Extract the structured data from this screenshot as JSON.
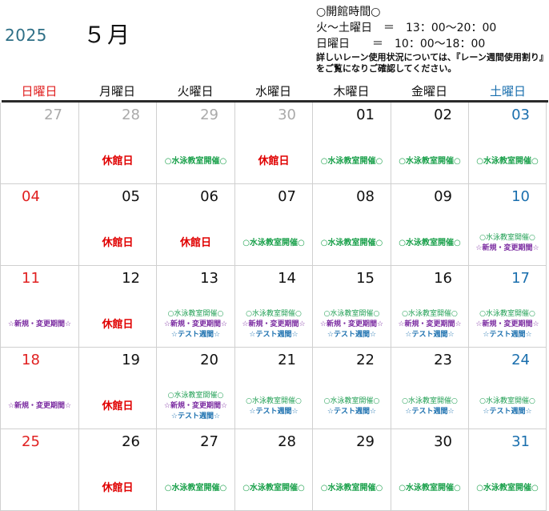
{
  "header": {
    "year": "2025",
    "month": "５月",
    "hours_title": "○開館時間○",
    "hours_weekday": "火～土曜日　＝　13：00～20：00",
    "hours_sunday": "日曜日　　＝　10：00～18：00",
    "note_line1": "詳しいレーン使用状況については、『レーン週間使用割り』",
    "note_line2": "をご覧になりご確認してください。"
  },
  "weekdays": [
    {
      "label": "日曜日",
      "kind": "sun"
    },
    {
      "label": "月曜日",
      "kind": "wd"
    },
    {
      "label": "火曜日",
      "kind": "wd"
    },
    {
      "label": "水曜日",
      "kind": "wd"
    },
    {
      "label": "木曜日",
      "kind": "wd"
    },
    {
      "label": "金曜日",
      "kind": "wd"
    },
    {
      "label": "土曜日",
      "kind": "sat"
    }
  ],
  "labels": {
    "closed": "休館日",
    "swim": "○水泳教室開催○",
    "newreg": "☆新規・変更期間☆",
    "test": "☆テスト週間☆"
  },
  "colors": {
    "sunday": "#e02020",
    "saturday": "#1a6fae",
    "closed": "#e00000",
    "swim": "#19a04a",
    "newreg": "#7a2aa0",
    "test": "#1a6fae"
  },
  "weeks": [
    [
      {
        "day": "27",
        "other": true,
        "events": []
      },
      {
        "day": "28",
        "other": true,
        "events": [
          "closed"
        ]
      },
      {
        "day": "29",
        "other": true,
        "events": [
          "swim"
        ]
      },
      {
        "day": "30",
        "other": true,
        "events": [
          "closed"
        ]
      },
      {
        "day": "01",
        "events": [
          "swim"
        ]
      },
      {
        "day": "02",
        "events": [
          "swim"
        ]
      },
      {
        "day": "03",
        "events": [
          "swim"
        ]
      }
    ],
    [
      {
        "day": "04",
        "events": []
      },
      {
        "day": "05",
        "events": [
          "closed"
        ]
      },
      {
        "day": "06",
        "events": [
          "closed"
        ]
      },
      {
        "day": "07",
        "events": [
          "swim"
        ]
      },
      {
        "day": "08",
        "events": [
          "swim"
        ]
      },
      {
        "day": "09",
        "events": [
          "swim"
        ]
      },
      {
        "day": "10",
        "events": [
          "swim_small",
          "newreg"
        ]
      }
    ],
    [
      {
        "day": "11",
        "events": [
          "newreg"
        ]
      },
      {
        "day": "12",
        "events": [
          "closed"
        ]
      },
      {
        "day": "13",
        "events": [
          "swim_small",
          "newreg",
          "test"
        ]
      },
      {
        "day": "14",
        "events": [
          "swim_small",
          "newreg",
          "test"
        ]
      },
      {
        "day": "15",
        "events": [
          "swim_small",
          "newreg",
          "test"
        ]
      },
      {
        "day": "16",
        "events": [
          "swim_small",
          "newreg",
          "test"
        ]
      },
      {
        "day": "17",
        "events": [
          "swim_small",
          "newreg",
          "test"
        ]
      }
    ],
    [
      {
        "day": "18",
        "events": [
          "newreg"
        ]
      },
      {
        "day": "19",
        "events": [
          "closed"
        ]
      },
      {
        "day": "20",
        "events": [
          "swim_small",
          "newreg",
          "test"
        ]
      },
      {
        "day": "21",
        "events": [
          "swim_small",
          "test"
        ]
      },
      {
        "day": "22",
        "events": [
          "swim_small",
          "test"
        ]
      },
      {
        "day": "23",
        "events": [
          "swim_small",
          "test"
        ]
      },
      {
        "day": "24",
        "events": [
          "swim_small",
          "test"
        ]
      }
    ],
    [
      {
        "day": "25",
        "events": []
      },
      {
        "day": "26",
        "events": [
          "closed"
        ]
      },
      {
        "day": "27",
        "events": [
          "swim"
        ]
      },
      {
        "day": "28",
        "events": [
          "swim"
        ]
      },
      {
        "day": "29",
        "events": [
          "swim"
        ]
      },
      {
        "day": "30",
        "events": [
          "swim"
        ]
      },
      {
        "day": "31",
        "events": [
          "swim"
        ]
      }
    ]
  ]
}
